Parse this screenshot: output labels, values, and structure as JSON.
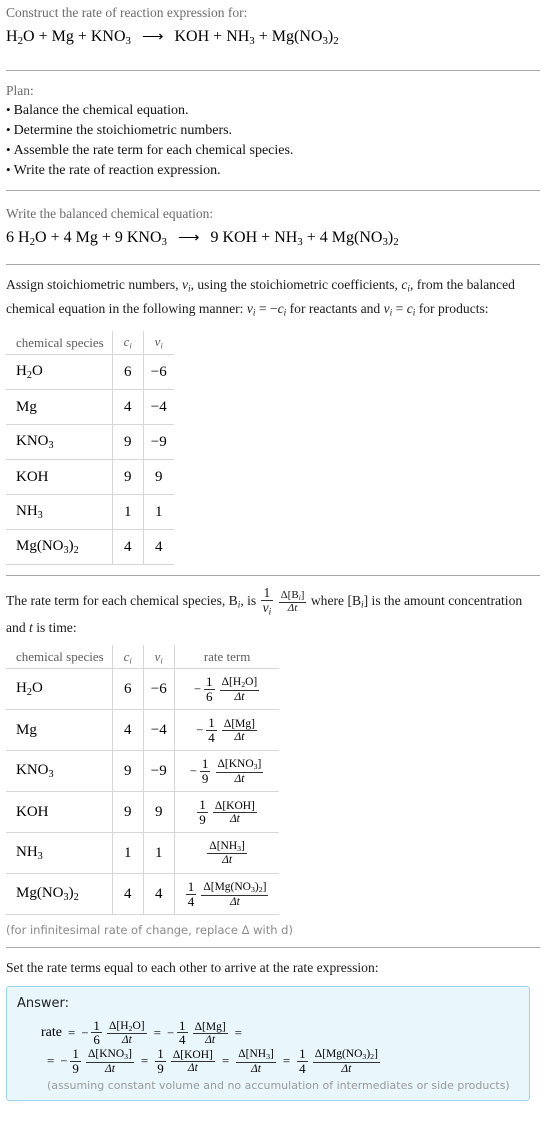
{
  "header": {
    "prompt": "Construct the rate of reaction expression for:",
    "equation": {
      "reactants": [
        "H_2O",
        "Mg",
        "KNO_3"
      ],
      "products": [
        "KOH",
        "NH_3",
        "Mg(NO_3)_2"
      ],
      "arrow": "⟶"
    }
  },
  "plan": {
    "title": "Plan:",
    "items": [
      "Balance the chemical equation.",
      "Determine the stoichiometric numbers.",
      "Assemble the rate term for each chemical species.",
      "Write the rate of reaction expression."
    ],
    "bullet": "•"
  },
  "balanced": {
    "title": "Write the balanced chemical equation:",
    "reactant_coeffs": [
      "6",
      "4",
      "9"
    ],
    "reactants": [
      "H_2O",
      "Mg",
      "KNO_3"
    ],
    "product_coeffs": [
      "9",
      "",
      "4"
    ],
    "products": [
      "KOH",
      "NH_3",
      "Mg(NO_3)_2"
    ],
    "arrow": "⟶"
  },
  "stoich": {
    "paragraph_1": "Assign stoichiometric numbers, ",
    "paragraph_2": ", using the stoichiometric coefficients, ",
    "paragraph_3": ", from the balanced chemical equation in the following manner: ",
    "paragraph_4": " for reactants and ",
    "paragraph_5": " for products:",
    "nu_symbol": "ν_i",
    "c_symbol": "c_i",
    "rule_reactants": "ν_i = −c_i",
    "rule_products": "ν_i = c_i",
    "table": {
      "headers": [
        "chemical species",
        "c_i",
        "ν_i"
      ],
      "rows": [
        {
          "species": "H_2O",
          "c": "6",
          "nu": "−6"
        },
        {
          "species": "Mg",
          "c": "4",
          "nu": "−4"
        },
        {
          "species": "KNO_3",
          "c": "9",
          "nu": "−9"
        },
        {
          "species": "KOH",
          "c": "9",
          "nu": "9"
        },
        {
          "species": "NH_3",
          "c": "1",
          "nu": "1"
        },
        {
          "species": "Mg(NO_3)_2",
          "c": "4",
          "nu": "4"
        }
      ]
    }
  },
  "rateterm": {
    "paragraph_1": "The rate term for each chemical species, B",
    "paragraph_2": ", is ",
    "paragraph_3": " where [B",
    "paragraph_4": "] is the amount concentration and ",
    "paragraph_5": " is time:",
    "formula_num": "1",
    "formula_den": "ν_i",
    "delta_num": "Δ[B_i]",
    "delta_den": "Δt",
    "t_symbol": "t",
    "table": {
      "headers": [
        "chemical species",
        "c_i",
        "ν_i",
        "rate term"
      ],
      "rows": [
        {
          "species": "H_2O",
          "c": "6",
          "nu": "−6",
          "sign": "−",
          "coef_num": "1",
          "coef_den": "6",
          "delta_num": "Δ[H_2O]",
          "delta_den": "Δt"
        },
        {
          "species": "Mg",
          "c": "4",
          "nu": "−4",
          "sign": "−",
          "coef_num": "1",
          "coef_den": "4",
          "delta_num": "Δ[Mg]",
          "delta_den": "Δt"
        },
        {
          "species": "KNO_3",
          "c": "9",
          "nu": "−9",
          "sign": "−",
          "coef_num": "1",
          "coef_den": "9",
          "delta_num": "Δ[KNO_3]",
          "delta_den": "Δt"
        },
        {
          "species": "KOH",
          "c": "9",
          "nu": "9",
          "sign": "",
          "coef_num": "1",
          "coef_den": "9",
          "delta_num": "Δ[KOH]",
          "delta_den": "Δt"
        },
        {
          "species": "NH_3",
          "c": "1",
          "nu": "1",
          "sign": "",
          "coef_num": "",
          "coef_den": "",
          "delta_num": "Δ[NH_3]",
          "delta_den": "Δt"
        },
        {
          "species": "Mg(NO_3)_2",
          "c": "4",
          "nu": "4",
          "sign": "",
          "coef_num": "1",
          "coef_den": "4",
          "delta_num": "Δ[Mg(NO_3)_2]",
          "delta_den": "Δt"
        }
      ]
    },
    "note": "(for infinitesimal rate of change, replace Δ with d)"
  },
  "answer": {
    "intro": "Set the rate terms equal to each other to arrive at the rate expression:",
    "label": "Answer:",
    "rate_label": "rate",
    "equals": "=",
    "terms": [
      {
        "sign": "−",
        "coef_num": "1",
        "coef_den": "6",
        "delta_num": "Δ[H_2O]",
        "delta_den": "Δt"
      },
      {
        "sign": "−",
        "coef_num": "1",
        "coef_den": "4",
        "delta_num": "Δ[Mg]",
        "delta_den": "Δt"
      },
      {
        "sign": "−",
        "coef_num": "1",
        "coef_den": "9",
        "delta_num": "Δ[KNO_3]",
        "delta_den": "Δt"
      },
      {
        "sign": "",
        "coef_num": "1",
        "coef_den": "9",
        "delta_num": "Δ[KOH]",
        "delta_den": "Δt"
      },
      {
        "sign": "",
        "coef_num": "",
        "coef_den": "",
        "delta_num": "Δ[NH_3]",
        "delta_den": "Δt"
      },
      {
        "sign": "",
        "coef_num": "1",
        "coef_den": "4",
        "delta_num": "Δ[Mg(NO_3)_2]",
        "delta_den": "Δt"
      }
    ],
    "assumption": "(assuming constant volume and no accumulation of intermediates or side products)"
  },
  "colors": {
    "answer_bg": "#e9f6fc",
    "answer_border": "#9fd3ea",
    "divider": "#a8a8a8",
    "muted_text": "#6b6b6b"
  }
}
